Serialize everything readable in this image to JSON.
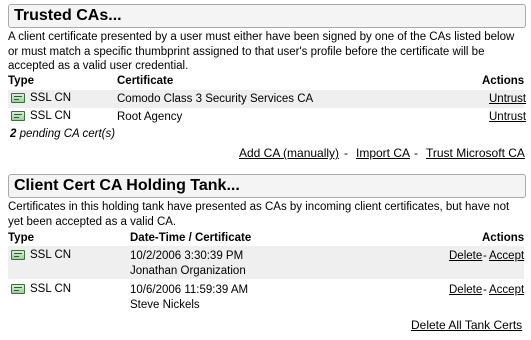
{
  "trusted": {
    "title": "Trusted CAs...",
    "description": "A client certificate presented by a user must either have been signed by one of the CAs listed below or must match a specific thumbprint assigned to that user's profile before the certificate will be accepted as a valid user credential.",
    "columns": {
      "type": "Type",
      "certificate": "Certificate",
      "actions": "Actions"
    },
    "rows": [
      {
        "type": "SSL CN",
        "certificate": "Comodo Class 3 Security Services CA",
        "action": "Untrust",
        "icon": "certificate-icon"
      },
      {
        "type": "SSL CN",
        "certificate": "Root Agency",
        "action": "Untrust",
        "icon": "certificate-icon"
      }
    ],
    "pending_count": "2",
    "pending_text": " pending CA cert(s)",
    "footer_links": {
      "add": "Add CA (manually)",
      "import": "Import CA",
      "trust_ms": "Trust Microsoft CA",
      "sep": "-"
    }
  },
  "tank": {
    "title": "Client Cert CA Holding Tank...",
    "description": "Certificates in this holding tank have presented as CAs by incoming client certificates, but have not yet been accepted as a valid CA.",
    "columns": {
      "type": "Type",
      "datetime": "Date-Time / Certificate",
      "actions": "Actions"
    },
    "rows": [
      {
        "type": "SSL CN",
        "datetime": "10/2/2006 3:30:39 PM",
        "certificate": "Jonathan Organization",
        "delete": "Delete",
        "accept": "Accept",
        "sep": "-",
        "icon": "certificate-icon"
      },
      {
        "type": "SSL CN",
        "datetime": "10/6/2006 11:59:39 AM",
        "certificate": "Steve Nickels",
        "delete": "Delete",
        "accept": "Accept",
        "sep": "-",
        "icon": "certificate-icon"
      }
    ],
    "footer_link": "Delete All Tank Certs"
  }
}
